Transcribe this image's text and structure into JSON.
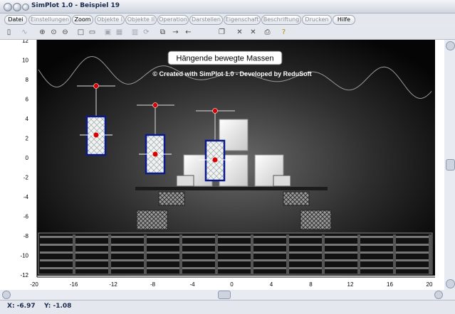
{
  "window": {
    "title": "SimPlot 1.0 - Beispiel 19"
  },
  "menu": [
    {
      "label": "Datei",
      "active": true
    },
    {
      "label": "Einstellungen",
      "active": false
    },
    {
      "label": "Zoom",
      "active": true
    },
    {
      "label": "Objekte I",
      "active": false
    },
    {
      "label": "Objekte II",
      "active": false
    },
    {
      "label": "Operation",
      "active": false
    },
    {
      "label": "Darstellen",
      "active": false
    },
    {
      "label": "Eigenschaft",
      "active": false
    },
    {
      "label": "Beschriftung",
      "active": false
    },
    {
      "label": "Drucken",
      "active": false
    },
    {
      "label": "Hilfe",
      "active": true
    }
  ],
  "toolbar": {
    "icons": [
      "phone-icon",
      "func-icon",
      "zoom-in-icon",
      "zoom-fit-icon",
      "zoom-out-icon",
      "square-icon",
      "boxes-icon",
      "grid-icon",
      "grid2-icon",
      "grid3-icon",
      "refresh-icon",
      "copy-icon",
      "arrow-right-icon",
      "arrow-left-icon",
      "page-icon",
      "x-icon",
      "x2-icon",
      "print-icon",
      "help-icon"
    ]
  },
  "plot": {
    "title": "Hängende bewegte Massen",
    "credit": "© Created with SimPlot 1.0 - Developed by ReduSoft",
    "x_ticks": [
      "-20",
      "-16",
      "-12",
      "-8",
      "-4",
      "0",
      "4",
      "8",
      "12",
      "16",
      "20"
    ],
    "y_ticks": [
      "12",
      "10",
      "8",
      "6",
      "4",
      "2",
      "0",
      "-2",
      "-4",
      "-6",
      "-8",
      "-10",
      "-12"
    ]
  },
  "status": {
    "x": "X: -6.97",
    "y": "Y: -1.08"
  }
}
